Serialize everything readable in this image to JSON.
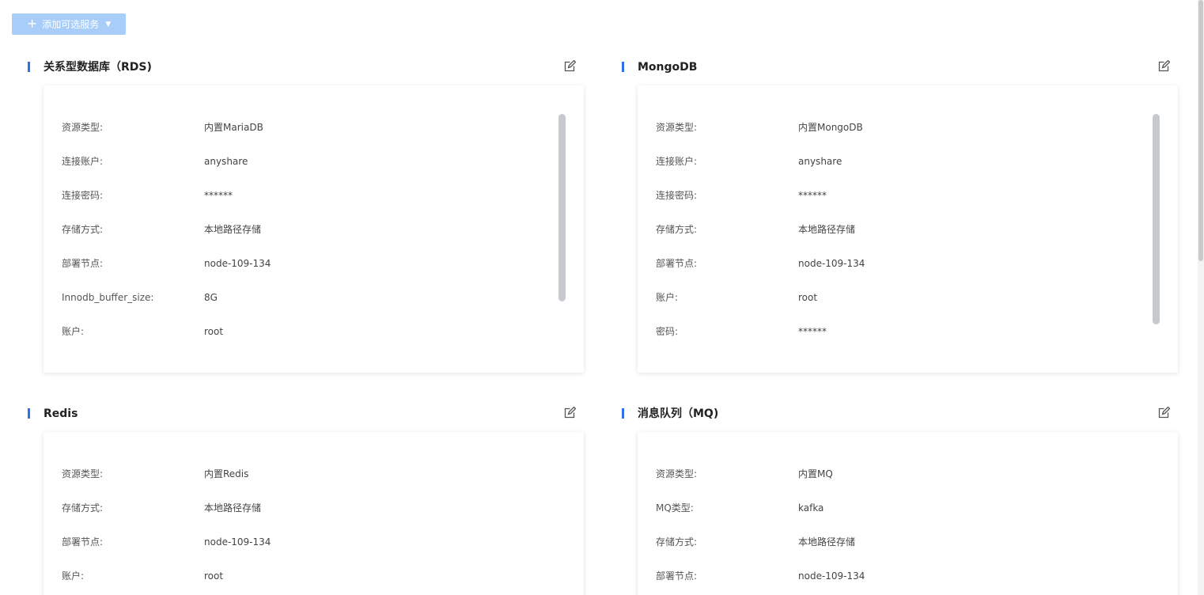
{
  "toolbar": {
    "add_label": "添加可选服务"
  },
  "sections": {
    "rds": {
      "title": "关系型数据库（RDS)",
      "rows": [
        {
          "k": "资源类型:",
          "v": "内置MariaDB"
        },
        {
          "k": "连接账户:",
          "v": "anyshare"
        },
        {
          "k": "连接密码:",
          "v": "******"
        },
        {
          "k": "存储方式:",
          "v": "本地路径存储"
        },
        {
          "k": "部署节点:",
          "v": "node-109-134"
        },
        {
          "k": "Innodb_buffer_size:",
          "v": "8G"
        },
        {
          "k": "账户:",
          "v": "root"
        }
      ]
    },
    "mongodb": {
      "title": "MongoDB",
      "rows": [
        {
          "k": "资源类型:",
          "v": "内置MongoDB"
        },
        {
          "k": "连接账户:",
          "v": "anyshare"
        },
        {
          "k": "连接密码:",
          "v": "******"
        },
        {
          "k": "存储方式:",
          "v": "本地路径存储"
        },
        {
          "k": "部署节点:",
          "v": "node-109-134"
        },
        {
          "k": "账户:",
          "v": "root"
        },
        {
          "k": "密码:",
          "v": "******"
        }
      ]
    },
    "redis": {
      "title": "Redis",
      "rows": [
        {
          "k": "资源类型:",
          "v": "内置Redis"
        },
        {
          "k": "存储方式:",
          "v": "本地路径存储"
        },
        {
          "k": "部署节点:",
          "v": "node-109-134"
        },
        {
          "k": "账户:",
          "v": "root"
        }
      ]
    },
    "mq": {
      "title": "消息队列（MQ)",
      "rows": [
        {
          "k": "资源类型:",
          "v": "内置MQ"
        },
        {
          "k": "MQ类型:",
          "v": "kafka"
        },
        {
          "k": "存储方式:",
          "v": "本地路径存储"
        },
        {
          "k": "部署节点:",
          "v": "node-109-134"
        }
      ]
    }
  },
  "colors": {
    "accent": "#2f6fed",
    "button_bg": "#a8cdf9"
  },
  "icons": {
    "edit": "edit-icon",
    "add": "plus-icon",
    "dropdown": "caret-down-icon"
  }
}
